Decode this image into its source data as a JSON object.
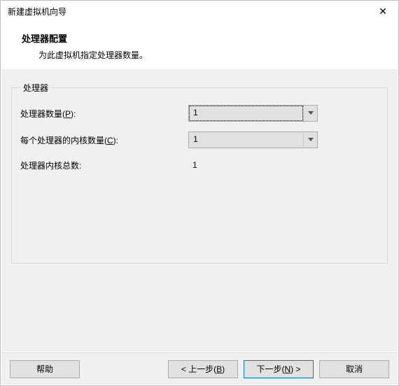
{
  "window": {
    "title": "新建虚拟机向导",
    "close": "✕"
  },
  "header": {
    "title": "处理器配置",
    "subtitle": "为此虚拟机指定处理器数量。"
  },
  "group": {
    "legend": "处理器",
    "rows": {
      "proc_count": {
        "label_pre": "处理器数量(",
        "hotkey": "P",
        "label_post": "):",
        "value": "1"
      },
      "cores_per": {
        "label_pre": "每个处理器的内核数量(",
        "hotkey": "C",
        "label_post": "):",
        "value": "1"
      },
      "total": {
        "label": "处理器内核总数:",
        "value": "1"
      }
    }
  },
  "footer": {
    "help": "帮助",
    "back_pre": "< 上一步(",
    "back_hot": "B",
    "back_post": ")",
    "next_pre": "下一步(",
    "next_hot": "N",
    "next_post": ") >",
    "cancel": "取消"
  }
}
